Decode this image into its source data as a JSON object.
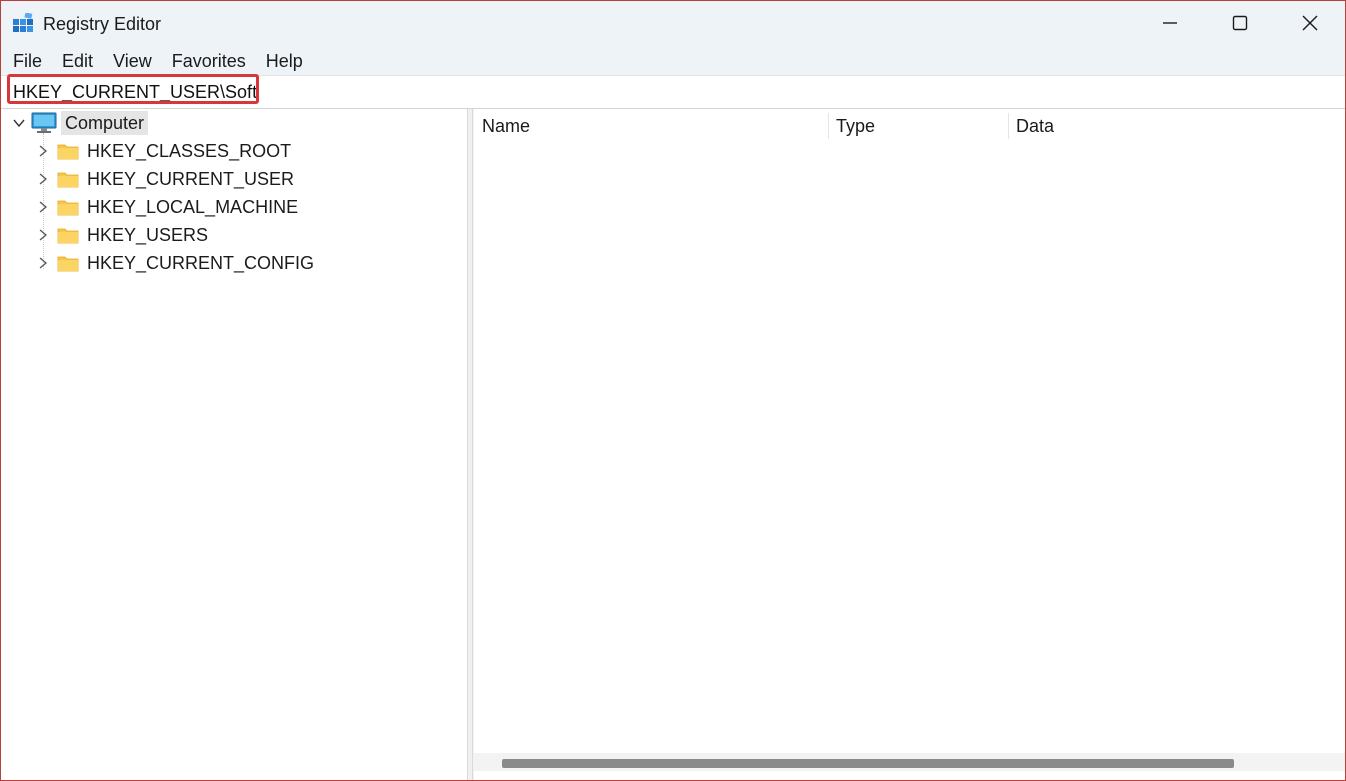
{
  "window": {
    "title": "Registry Editor",
    "app_icon": "registry-editor-icon",
    "caption_buttons": [
      "minimize-icon",
      "maximize-icon",
      "close-icon"
    ]
  },
  "menu": [
    "File",
    "Edit",
    "View",
    "Favorites",
    "Help"
  ],
  "address_bar": {
    "value": "HKEY_CURRENT_USER\\Software",
    "highlight_color": "#d7373a"
  },
  "tree": {
    "root": {
      "label": "Computer",
      "icon": "computer-icon",
      "expanded": true
    },
    "children": [
      {
        "label": "HKEY_CLASSES_ROOT",
        "icon": "folder-icon"
      },
      {
        "label": "HKEY_CURRENT_USER",
        "icon": "folder-icon"
      },
      {
        "label": "HKEY_LOCAL_MACHINE",
        "icon": "folder-icon"
      },
      {
        "label": "HKEY_USERS",
        "icon": "folder-icon"
      },
      {
        "label": "HKEY_CURRENT_CONFIG",
        "icon": "folder-icon"
      }
    ]
  },
  "list": {
    "columns": [
      "Name",
      "Type",
      "Data"
    ],
    "rows": []
  },
  "colors": {
    "folder": "#f8c74a",
    "selection_bg": "#e5e5e5",
    "window_border": "#b8403b"
  }
}
